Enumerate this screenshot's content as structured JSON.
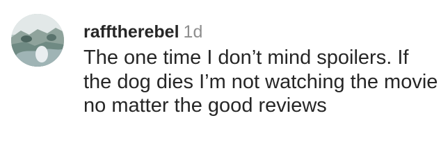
{
  "comment": {
    "username": "rafftherebel",
    "timestamp": "1d",
    "avatar_icon": "user-avatar-photo",
    "text": "The one time I don’t mind spoilers. If the dog dies I’m not watching the movie no matter the good reviews"
  }
}
